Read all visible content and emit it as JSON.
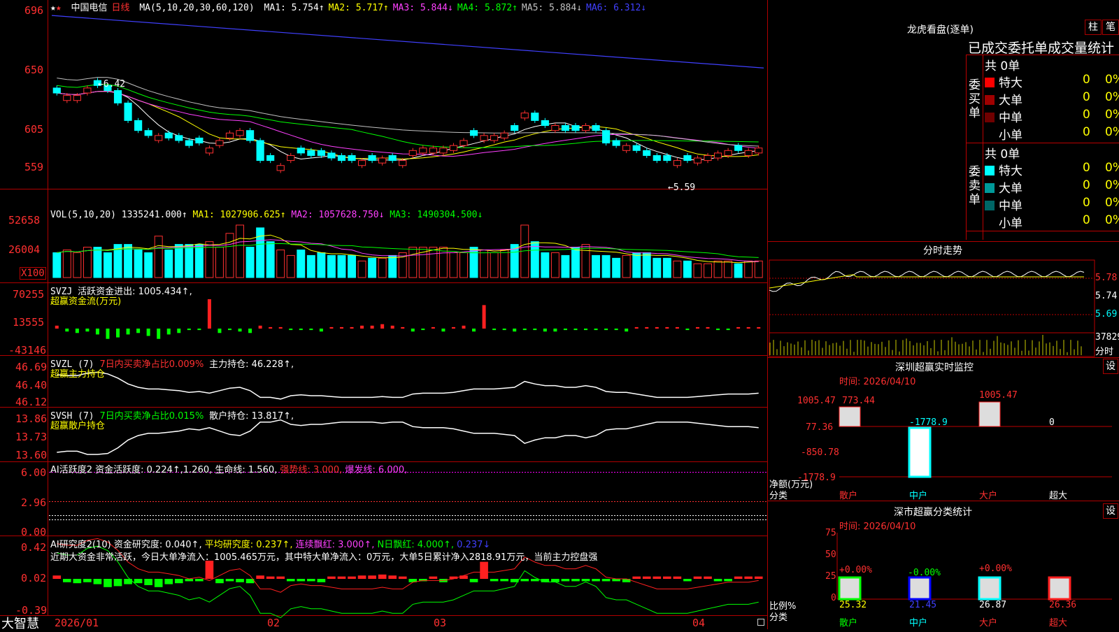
{
  "header": {
    "star": "★",
    "star2": "★",
    "stock_name": "中国电信",
    "period": "日线",
    "ma_label": "MA(5,10,20,30,60,120)",
    "ma": [
      {
        "label": "MA1: 5.754↑",
        "color": "#ffffff"
      },
      {
        "label": "MA2: 5.717↑",
        "color": "#ffff00"
      },
      {
        "label": "MA3: 5.844↓",
        "color": "#ff40ff"
      },
      {
        "label": "MA4: 5.872↑",
        "color": "#00ff00"
      },
      {
        "label": "MA5: 5.884↓",
        "color": "#c0c0c0"
      },
      {
        "label": "MA6: 6.312↓",
        "color": "#4040ff"
      }
    ]
  },
  "price_axis": [
    "696",
    "650",
    "605",
    "559"
  ],
  "annotations": {
    "high": "6.42",
    "low": "5.59"
  },
  "vol_panel": {
    "title": "VOL(5,10,20)",
    "value": "1335241.000↑",
    "ma1": "MA1: 1027906.625↑",
    "ma2": "MA2: 1057628.750↓",
    "ma3": "MA3: 1490304.500↓",
    "axis": [
      "52658",
      "26004"
    ],
    "unit": "X100"
  },
  "svzj_panel": {
    "title": "SVZJ",
    "label": "活跃资金进出: 1005.434↑,",
    "sub": "超赢资金流(万元)",
    "axis": [
      "70255",
      "13555",
      "-43146"
    ]
  },
  "svzl_panel": {
    "title": "SVZL (7)",
    "label1": "7日内买卖净占比0.009%",
    "label2": "主力持仓: 46.228↑,",
    "sub": "超赢主力持仓",
    "axis": [
      "46.69",
      "46.40",
      "46.12"
    ]
  },
  "svsh_panel": {
    "title": "SVSH (7)",
    "label1": "7日内买卖净占比0.015%",
    "label2": "散户持仓: 13.817↑,",
    "sub": "超赢散户持仓",
    "axis": [
      "13.86",
      "13.73",
      "13.60"
    ]
  },
  "ai_active": {
    "title": "AI活跃度2",
    "l1": "资金活跃度: 0.224↑,1.260,",
    "l2": "生命线: 1.560,",
    "l3": "强势线: 3.000,",
    "l4": "爆发线: 6.000,",
    "axis": [
      "6.00",
      "2.96",
      "0.00"
    ]
  },
  "ai_research": {
    "title": "AI研究度2(10)",
    "l1": "资金研究度: 0.040↑,",
    "l2": "平均研究度: 0.237↑,",
    "l3": "连续飘红: 3.000↑,",
    "l4": "N日飘红: 4.000↑,",
    "l5": "0.237↓",
    "note": "近期大资金非常活跃，今日大单净流入：1005.465万元，其中特大单净流入：0万元，大单5日累计净入2818.91万元，当前主力控盘强",
    "axis": [
      "0.42",
      "0.02",
      "-0.39"
    ]
  },
  "time_axis": [
    "2026/01",
    "02",
    "03",
    "04"
  ],
  "brand": "大智慧",
  "right": {
    "dragon_title": "龙虎看盘(逐单)",
    "btn_zhu": "柱",
    "btn_bi": "笔",
    "stats_title": "已成交委托单成交量统计",
    "buy_label": "委买单",
    "sell_label": "委卖单",
    "buy_total": "共 0单",
    "sell_total": "共 0单",
    "buy_rows": [
      {
        "name": "特大",
        "count": "0",
        "pct": "0%",
        "color": "#ff0000"
      },
      {
        "name": "大单",
        "count": "0",
        "pct": "0%",
        "color": "#a00000"
      },
      {
        "name": "中单",
        "count": "0",
        "pct": "0%",
        "color": "#700000"
      },
      {
        "name": "小单",
        "count": "0",
        "pct": "0%",
        "color": "#000000"
      }
    ],
    "sell_rows": [
      {
        "name": "特大",
        "count": "0",
        "pct": "0%",
        "color": "#00ffff"
      },
      {
        "name": "大单",
        "count": "0",
        "pct": "0%",
        "color": "#009999"
      },
      {
        "name": "中单",
        "count": "0",
        "pct": "0%",
        "color": "#006666"
      },
      {
        "name": "小单",
        "count": "0",
        "pct": "0%",
        "color": "#000000"
      }
    ],
    "intraday_title": "分时走势",
    "intraday_axis": [
      "5.78",
      "5.74",
      "5.69"
    ],
    "intraday_vol": "37829",
    "intraday_label": "分时",
    "monitor_title": "深圳超赢实时监控",
    "monitor_btn": "设",
    "monitor_time": "时间: 2026/04/10",
    "monitor_axis": [
      "1005.47",
      "77.36",
      "-850.78",
      "-1778.9"
    ],
    "monitor_values": [
      "773.44",
      "-1778.9",
      "1005.47",
      "0"
    ],
    "monitor_ylabel": "净额(万元)",
    "monitor_xlabel": "分类",
    "monitor_cats": [
      "散户",
      "中户",
      "大户",
      "超大"
    ],
    "class_title": "深市超赢分类统计",
    "class_btn": "设",
    "class_time": "时间: 2026/04/10",
    "class_axis": [
      "75",
      "50",
      "25",
      "0"
    ],
    "class_pcts": [
      "+0.00%",
      "-0.00%",
      "+0.00%"
    ],
    "class_values": [
      "25.32",
      "21.45",
      "26.87",
      "26.36"
    ],
    "class_ylabel": "比例%",
    "class_xlabel": "分类",
    "class_cats": [
      "散户",
      "中户",
      "大户",
      "超大"
    ]
  },
  "chart_data": {
    "type": "candlestick",
    "price_range": [
      5.59,
      6.96
    ],
    "closes": [
      6.3,
      6.28,
      6.28,
      6.34,
      6.36,
      6.32,
      6.22,
      6.08,
      6.0,
      5.96,
      5.96,
      5.94,
      5.92,
      5.88,
      5.9,
      5.86,
      5.92,
      5.98,
      6.0,
      5.92,
      5.76,
      5.76,
      5.72,
      5.8,
      5.82,
      5.8,
      5.8,
      5.78,
      5.76,
      5.76,
      5.76,
      5.76,
      5.78,
      5.76,
      5.76,
      5.84,
      5.86,
      5.86,
      5.86,
      5.88,
      5.92,
      5.96,
      5.96,
      5.96,
      5.98,
      6.0,
      6.14,
      6.08,
      6.04,
      6.04,
      6.0,
      6.0,
      6.04,
      6.0,
      5.9,
      5.88,
      5.88,
      5.84,
      5.8,
      5.76,
      5.76,
      5.76,
      5.76,
      5.78,
      5.8,
      5.82,
      5.84,
      5.84,
      5.84,
      5.86
    ],
    "up": [
      false,
      true,
      true,
      true,
      false,
      false,
      false,
      false,
      false,
      false,
      true,
      false,
      false,
      false,
      false,
      true,
      true,
      true,
      true,
      false,
      false,
      false,
      true,
      true,
      false,
      false,
      false,
      false,
      false,
      false,
      true,
      false,
      true,
      false,
      true,
      true,
      true,
      true,
      true,
      true,
      true,
      false,
      true,
      true,
      true,
      false,
      true,
      false,
      false,
      true,
      false,
      false,
      true,
      false,
      false,
      false,
      true,
      false,
      false,
      false,
      false,
      true,
      false,
      true,
      true,
      true,
      true,
      false,
      true,
      true
    ],
    "volume_ratio": [
      0.45,
      0.5,
      0.45,
      0.55,
      0.55,
      0.45,
      0.6,
      0.6,
      0.5,
      0.45,
      0.75,
      0.5,
      0.6,
      0.6,
      0.6,
      0.65,
      0.55,
      0.8,
      0.95,
      0.55,
      0.9,
      0.65,
      0.5,
      0.4,
      0.5,
      0.4,
      0.45,
      0.4,
      0.4,
      0.4,
      0.3,
      0.35,
      0.35,
      0.4,
      0.45,
      0.55,
      0.55,
      0.55,
      0.55,
      0.45,
      0.45,
      0.55,
      0.5,
      0.45,
      0.5,
      0.6,
      0.95,
      0.65,
      0.45,
      0.45,
      0.4,
      0.55,
      0.6,
      0.4,
      0.4,
      0.35,
      0.4,
      0.45,
      0.45,
      0.35,
      0.35,
      0.3,
      0.3,
      0.25,
      0.25,
      0.3,
      0.3,
      0.25,
      0.3,
      0.3
    ],
    "flow": [
      0.1,
      -0.1,
      -0.15,
      -0.1,
      -0.2,
      -0.35,
      -0.3,
      -0.2,
      -0.15,
      -0.25,
      -0.35,
      -0.2,
      -0.15,
      -0.05,
      -0.05,
      1.0,
      -0.15,
      -0.05,
      -0.1,
      -0.15,
      0.1,
      0.05,
      0.05,
      -0.05,
      -0.05,
      -0.05,
      -0.1,
      0.05,
      0.05,
      0.05,
      0.1,
      0.1,
      0.15,
      0.1,
      0.05,
      -0.1,
      -0.05,
      0.05,
      -0.1,
      0.05,
      0.1,
      -0.1,
      0.8,
      -0.05,
      -0.05,
      -0.1,
      -0.05,
      -0.05,
      -0.1,
      -0.1,
      -0.05,
      -0.05,
      -0.05,
      -0.05,
      -0.05,
      -0.05,
      -0.1,
      0.05,
      0.05,
      0.05,
      0.05,
      0.05,
      -0.05,
      0.05,
      0.05,
      -0.05,
      -0.05,
      0.05,
      0.05,
      0.05
    ]
  }
}
